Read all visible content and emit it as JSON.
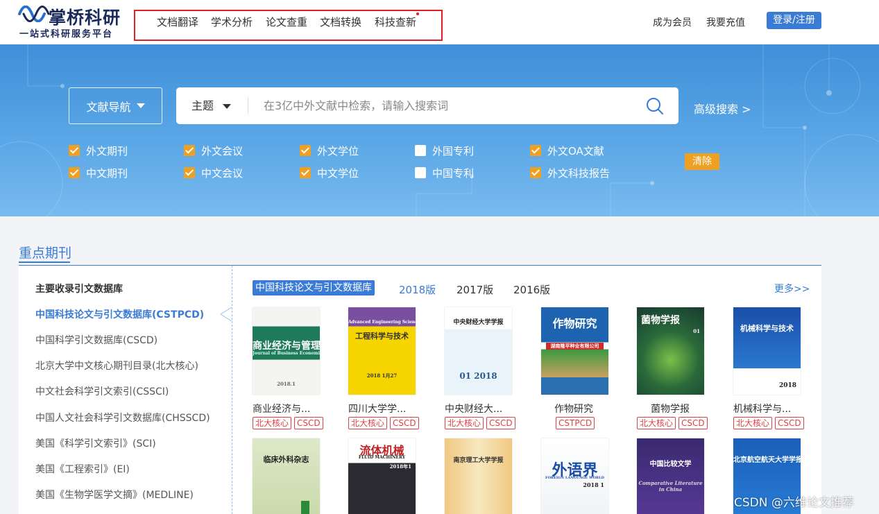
{
  "header": {
    "logo_title": "掌桥科研",
    "logo_subtitle": "一站式科研服务平台",
    "nav": [
      "文档翻译",
      "学术分析",
      "论文查重",
      "文档转换",
      "科技查新"
    ],
    "links": [
      "成为会员",
      "我要充值"
    ],
    "login": "登录/注册"
  },
  "search": {
    "nav_button": "文献导航",
    "field": "主题",
    "placeholder": "在3亿中外文献中检索，请输入搜索词",
    "advanced": "高级搜索 >",
    "clear": "清除",
    "checkboxes": [
      {
        "label": "外文期刊",
        "checked": true
      },
      {
        "label": "外文会议",
        "checked": true
      },
      {
        "label": "外文学位",
        "checked": true
      },
      {
        "label": "外国专利",
        "checked": false
      },
      {
        "label": "外文OA文献",
        "checked": true
      },
      {
        "label": "中文期刊",
        "checked": true
      },
      {
        "label": "中文会议",
        "checked": true
      },
      {
        "label": "中文学位",
        "checked": true
      },
      {
        "label": "中国专利",
        "checked": false
      },
      {
        "label": "外文科技报告",
        "checked": true
      }
    ]
  },
  "journals": {
    "section_title": "重点期刊",
    "sidebar_title": "主要收录引文数据库",
    "sidebar": [
      "中国科技论文与引文数据库(CSTPCD)",
      "中国科学引文数据库(CSCD)",
      "北京大学中文核心期刊目录(北大核心)",
      "中文社会科学引文索引(CSSCI)",
      "中国人文社会科学引文数据库(CHSSCD)",
      "美国《科学引文索引》(SCI)",
      "美国《工程索引》(EI)",
      "美国《生物学医学文摘》(MEDLINE)"
    ],
    "tabs": [
      "中国科技论文与引文数据库",
      "2018版",
      "2017版",
      "2016版"
    ],
    "more": "更多>>",
    "items": [
      {
        "name": "商业经济与...",
        "tags": [
          "北大核心",
          "CSCD"
        ],
        "cover_text": "商业经济与管理",
        "cover_en": "Journal of Business Economics",
        "cover_date": "2018.1"
      },
      {
        "name": "四川大学学...",
        "tags": [
          "北大核心",
          "CSCD"
        ],
        "cover_text": "工程科学与技术",
        "cover_en": "Advanced Engineering Sciences",
        "cover_date": "2018 1月27"
      },
      {
        "name": "中央财经大...",
        "tags": [
          "北大核心",
          "CSCD"
        ],
        "cover_text": "中央财经大学学报",
        "cover_date": "01 2018"
      },
      {
        "name": "作物研究",
        "tags": [
          "CSTPCD"
        ],
        "cover_text": "作物研究",
        "cover_banner": "湖南隆平种业有限公司"
      },
      {
        "name": "菌物学报",
        "tags": [
          "北大核心",
          "CSCD"
        ],
        "cover_text": "菌物学报",
        "cover_date": "01"
      },
      {
        "name": "机械科学与...",
        "tags": [
          "北大核心",
          "CSCD"
        ],
        "cover_text": "机械科学与技术",
        "cover_date": "2018"
      }
    ],
    "covers_row2": [
      {
        "cover_text": "临床外科杂志"
      },
      {
        "cover_text": "流体机械",
        "cover_en": "FLUID MACHINERY",
        "cover_date": "2018年1"
      },
      {
        "cover_text": "南京理工大学学报"
      },
      {
        "cover_text": "外语界",
        "cover_en": "FOREIGN LANGUAGE WORLD",
        "cover_date": "2018 1"
      },
      {
        "cover_text": "中国比较文学",
        "cover_en": "Comparative Literature in China"
      },
      {
        "cover_text": "北京航空航天大学学报"
      }
    ]
  },
  "watermark": "CSDN @六维论文推荐",
  "colors": {
    "primary": "#3a7bd5",
    "orange": "#f0a020",
    "tag_red": "#e04040"
  }
}
